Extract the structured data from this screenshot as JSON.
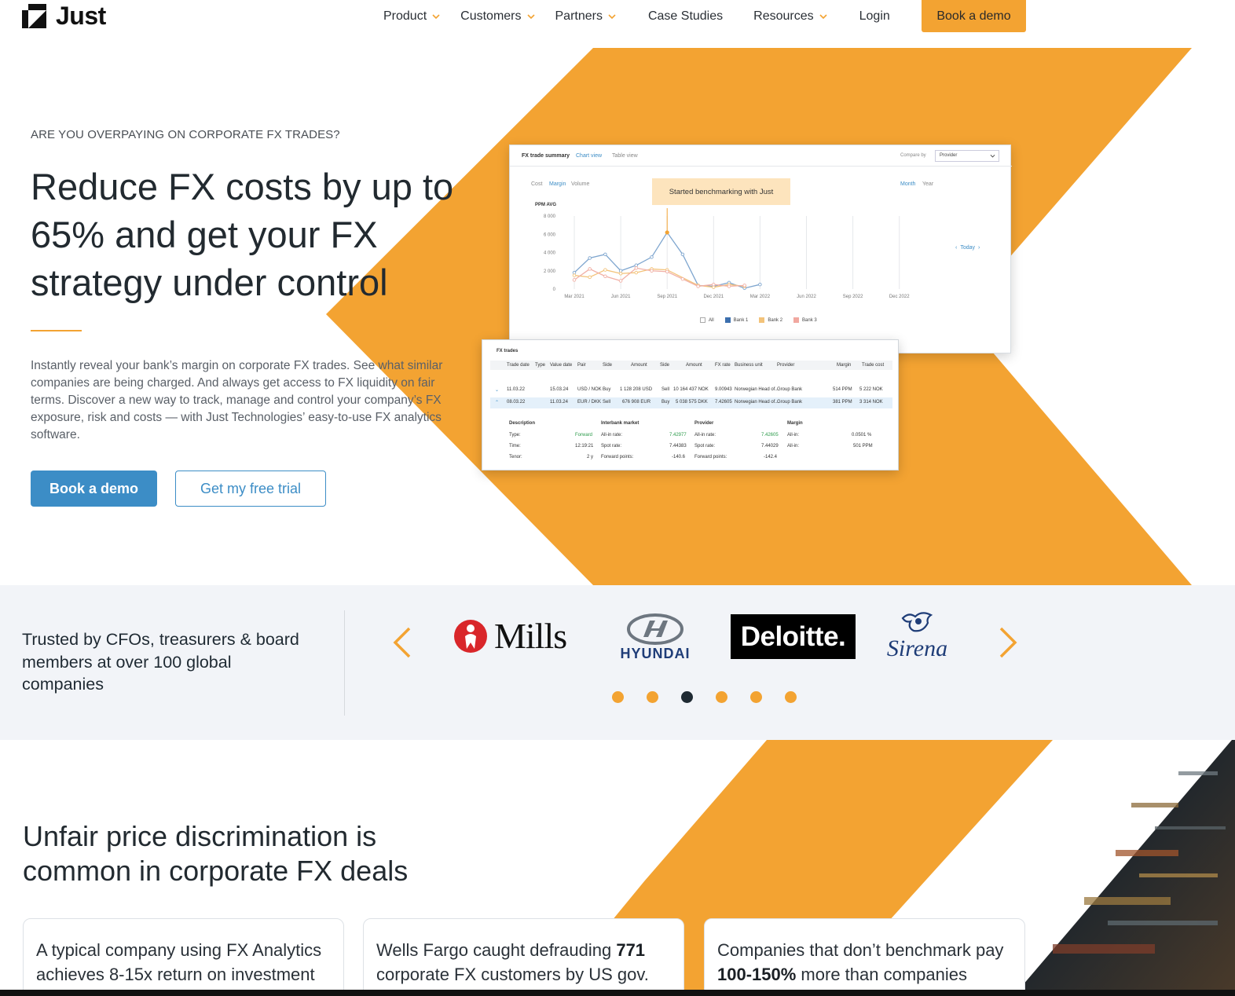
{
  "brand": {
    "name": "Just",
    "accent": "#f3a332",
    "primary": "#3c8dc6"
  },
  "nav": {
    "items": [
      {
        "label": "Product",
        "dropdown": true
      },
      {
        "label": "Customers",
        "dropdown": true
      },
      {
        "label": "Partners",
        "dropdown": true
      },
      {
        "label": "Case Studies",
        "dropdown": false
      },
      {
        "label": "Resources",
        "dropdown": true
      },
      {
        "label": "Login",
        "dropdown": false
      }
    ],
    "cta": "Book a demo"
  },
  "hero": {
    "eyebrow": "ARE YOU OVERPAYING ON CORPORATE FX TRADES?",
    "title": "Reduce FX costs by up to 65% and get your FX strategy under control",
    "text": "Instantly reveal your bank’s margin on corporate FX trades. See what similar companies are being charged. And always get access to FX liquidity on fair terms. Discover a new way to track, manage and control your company’s FX exposure, risk and costs — with Just Technologies’ easy-to-use FX analytics software.",
    "primary_button": "Book a demo",
    "secondary_button": "Get my free trial"
  },
  "dashboard": {
    "tabs": [
      "FX trade summary",
      "Chart view",
      "Table view"
    ],
    "compare_label": "Compare by",
    "compare_value": "Provider",
    "metrics": [
      "Cost",
      "Margin",
      "Volume"
    ],
    "periods": [
      "Month",
      "Year"
    ],
    "annotation": "Started benchmarking with Just",
    "y_title": "PPM AVG",
    "y_ticks": [
      "8 000",
      "6 000",
      "4 000",
      "2 000",
      "0"
    ],
    "x_ticks": [
      "Mar 2021",
      "Jun 2021",
      "Sep 2021",
      "Dec 2021",
      "Mar 2022",
      "Jun 2022",
      "Sep 2022",
      "Dec 2022"
    ],
    "today": "Today",
    "legend": [
      "All",
      "Bank 1",
      "Bank 2",
      "Bank 3"
    ]
  },
  "trades_table": {
    "title": "FX trades",
    "headers": [
      "Trade date",
      "Type",
      "Value date",
      "Pair",
      "Side",
      "Amount",
      "Side",
      "Amount",
      "FX rate",
      "Business unit",
      "Provider",
      "Margin",
      "Trade cost"
    ],
    "rows": [
      [
        "11.03.22",
        "15.03.24",
        "USD / NOK",
        "Buy",
        "1 128 208 USD",
        "Sell",
        "10 164 437 NOK",
        "9.00943",
        "Norwegian Head of...",
        "Group Bank",
        "514 PPM",
        "5 222 NOK"
      ],
      [
        "08.03.22",
        "11.03.24",
        "EUR / DKK",
        "Sell",
        "676 908 EUR",
        "Buy",
        "5 038 575 DKK",
        "7.42605",
        "Norwegian Head of...",
        "Group Bank",
        "381 PPM",
        "3 314 NOK"
      ]
    ],
    "detail": {
      "description": "Description",
      "interbank": "Interbank market",
      "provider": "Provider",
      "margin": "Margin",
      "type_label": "Type:",
      "type_value": "Forward",
      "time_label": "Time:",
      "time_value": "12:19:21",
      "tenor_label": "Tenor:",
      "tenor_value": "2 y",
      "ib_allin_label": "All-in rate:",
      "ib_allin": "7.42977",
      "ib_spot_label": "Spot rate:",
      "ib_spot": "7.44383",
      "ib_fwd_label": "Forward points:",
      "ib_fwd": "-140.6",
      "pr_allin": "7.42605",
      "pr_spot": "7.44029",
      "pr_fwd": "-142.4",
      "m_allin_label": "All-in:",
      "m1": "0.0501 %",
      "m2": "501 PPM"
    }
  },
  "trusted": {
    "text": "Trusted by CFOs, treasurers  & board members at over 100 global companies",
    "logos": [
      "Mills",
      "HYUNDAI",
      "Deloitte.",
      "Sirena"
    ],
    "dots": 6,
    "active_dot": 2
  },
  "lower": {
    "title": "Unfair price discrimination is common in corporate FX deals",
    "cards": [
      {
        "pre": "A typical company using FX Analytics achieves 8-15x return on investment",
        "bold": "",
        "post": ""
      },
      {
        "pre": "Wells Fargo caught defrauding ",
        "bold": "771",
        "post": " corporate FX customers by US gov."
      },
      {
        "pre": "Companies that don’t benchmark pay ",
        "bold": "100-150%",
        "post": " more than companies"
      }
    ]
  },
  "chart_data": {
    "type": "line",
    "x": [
      "Mar 2021",
      "Apr 2021",
      "May 2021",
      "Jun 2021",
      "Jul 2021",
      "Aug 2021",
      "Sep 2021",
      "Oct 2021",
      "Nov 2021",
      "Dec 2021",
      "Jan 2022",
      "Feb 2022",
      "Mar 2022"
    ],
    "series": [
      {
        "name": "Bank 1",
        "values": [
          1800,
          3400,
          3800,
          2000,
          2600,
          3500,
          6200,
          3800,
          400,
          300,
          700,
          100,
          500
        ]
      },
      {
        "name": "Bank 2",
        "values": [
          1500,
          1300,
          2100,
          1700,
          1800,
          2200,
          2100,
          null,
          400,
          200,
          500,
          300,
          null
        ]
      },
      {
        "name": "Bank 3",
        "values": [
          1000,
          2200,
          1400,
          900,
          2300,
          2000,
          1900,
          1100,
          300,
          500,
          300,
          400,
          null
        ]
      }
    ],
    "ylabel": "PPM AVG",
    "ylim": [
      0,
      8000
    ],
    "annotation": "Started benchmarking with Just"
  }
}
